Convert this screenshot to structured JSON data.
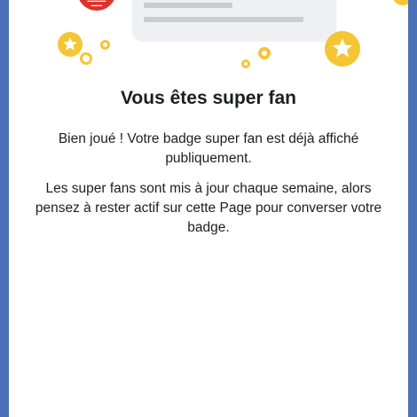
{
  "dialog": {
    "title": "Vous êtes super fan",
    "paragraph_1": "Bien joué ! Votre badge super fan est déjà affiché publiquement.",
    "paragraph_2": "Les super fans sont mis à jour chaque semaine, alors pensez à rester actif sur cette Page pour converser votre badge."
  },
  "colors": {
    "frame_blue": "#4a70b8",
    "badge_yellow": "#f5c534",
    "avatar_red": "#d9342b",
    "text_dark": "#1c1e21"
  },
  "icons": [
    "star-sparkle-icon",
    "ring-sparkle-icon",
    "page-avatar"
  ]
}
